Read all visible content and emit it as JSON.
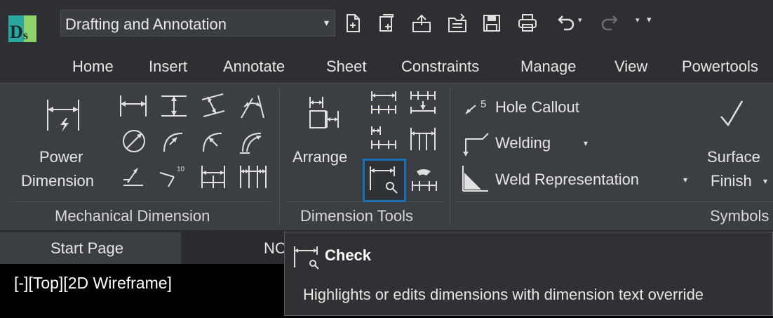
{
  "workspace": {
    "label": "Drafting and Annotation"
  },
  "quick_access": {
    "icons": [
      "new-file-icon",
      "new-sheet-set-icon",
      "open-file-icon",
      "open-folder-icon",
      "save-icon",
      "print-icon",
      "undo-icon",
      "redo-icon",
      "customize-icon"
    ]
  },
  "tabs": [
    "Home",
    "Insert",
    "Annotate",
    "Sheet",
    "Constraints",
    "Manage",
    "View",
    "Powertools"
  ],
  "ribbon": {
    "mechanical_dimension": {
      "title": "Mechanical Dimension",
      "power_dimension_line1": "Power",
      "power_dimension_line2": "Dimension"
    },
    "dimension_tools": {
      "title": "Dimension Tools",
      "arrange_label": "Arrange"
    },
    "symbols": {
      "title": "Symbols",
      "hole_callout": "Hole Callout",
      "welding": "Welding",
      "weld_representation": "Weld Representation",
      "surface_line1": "Surface",
      "surface_line2": "Finish",
      "superscript": "5"
    }
  },
  "doc_tabs": {
    "start_page": "Start Page",
    "drawing": "NC"
  },
  "viewport": {
    "label": "[-][Top][2D Wireframe]"
  },
  "tooltip": {
    "title": "Check",
    "description": "Highlights or edits dimensions with dimension text override"
  },
  "colors": {
    "accent": "#1a6fb8",
    "ribbon_bg": "#3b3f44",
    "titlebar_bg": "#2d2f33"
  }
}
